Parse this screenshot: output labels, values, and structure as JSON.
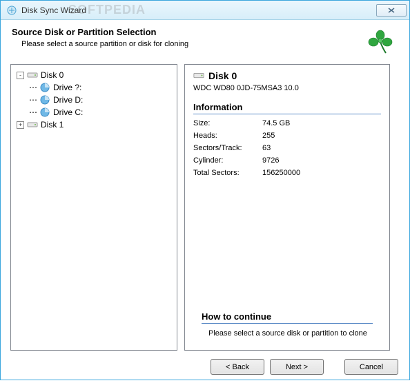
{
  "window": {
    "title": "Disk Sync Wizard",
    "watermark": "SOFTPEDIA"
  },
  "header": {
    "title": "Source Disk or Partition Selection",
    "subtitle": "Please select a source partition or disk for cloning"
  },
  "tree": {
    "disk0": {
      "label": "Disk 0",
      "expanded": "-"
    },
    "drives": [
      {
        "label": "Drive ?:"
      },
      {
        "label": "Drive D:"
      },
      {
        "label": "Drive C:"
      }
    ],
    "disk1": {
      "label": "Disk 1",
      "expanded": "+"
    }
  },
  "detail": {
    "title": "Disk 0",
    "model": "WDC WD80 0JD-75MSA3      10.0",
    "info_heading": "Information",
    "rows": [
      {
        "label": "Size:",
        "value": "74.5 GB"
      },
      {
        "label": "Heads:",
        "value": "255"
      },
      {
        "label": "Sectors/Track:",
        "value": "63"
      },
      {
        "label": "Cylinder:",
        "value": "9726"
      },
      {
        "label": "Total Sectors:",
        "value": "156250000"
      }
    ],
    "continue_heading": "How to continue",
    "continue_text": "Please select a source disk or partition to clone"
  },
  "footer": {
    "back": "< Back",
    "next": "Next >",
    "cancel": "Cancel"
  }
}
